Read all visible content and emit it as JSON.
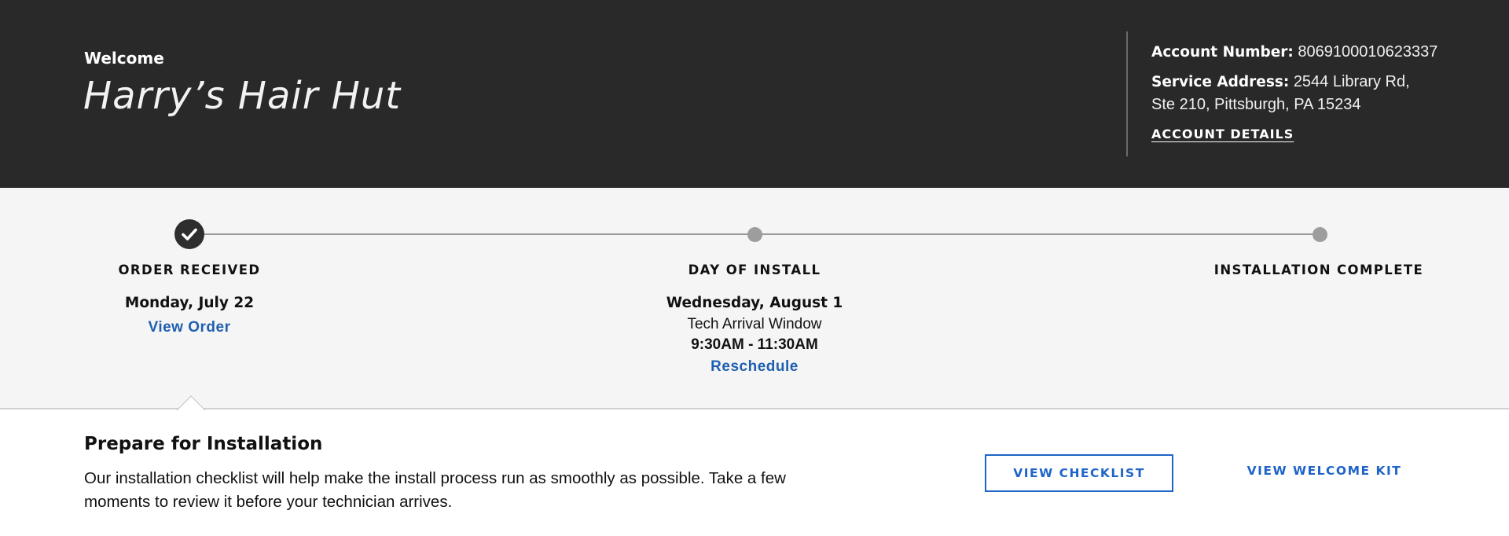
{
  "header": {
    "welcome_label": "Welcome",
    "business_name": "Harry’s Hair Hut",
    "account_number_label": "Account Number:",
    "account_number": "8069100010623337",
    "service_address_label": "Service Address:",
    "service_address_line1": "2544 Library Rd,",
    "service_address_line2": "Ste 210, Pittsburgh, PA 15234",
    "account_details_link": "ACCOUNT DETAILS"
  },
  "progress": {
    "steps": [
      {
        "title": "ORDER RECEIVED",
        "status": "complete",
        "date": "Monday, July 22",
        "link": "View Order"
      },
      {
        "title": "DAY OF INSTALL",
        "status": "pending",
        "date": "Wednesday, August 1",
        "window_label": "Tech Arrival Window",
        "window_time": "9:30AM - 11:30AM",
        "link": "Reschedule"
      },
      {
        "title": "INSTALLATION COMPLETE",
        "status": "pending"
      }
    ]
  },
  "prepare": {
    "title": "Prepare for Installation",
    "description": "Our installation checklist will help make the install process run as smoothly as possible. Take a few moments to review it before your technician arrives.",
    "checklist_button": "VIEW CHECKLIST",
    "welcome_kit_link": "VIEW WELCOME KIT"
  },
  "colors": {
    "header_bg": "#292929",
    "band_bg": "#f5f5f5",
    "link_blue": "#1f5fb0",
    "button_blue": "#1f64c8",
    "step_done": "#2e2e2e",
    "step_pending": "#9d9d9d"
  },
  "icons": {
    "step_complete": "checkmark-icon"
  }
}
